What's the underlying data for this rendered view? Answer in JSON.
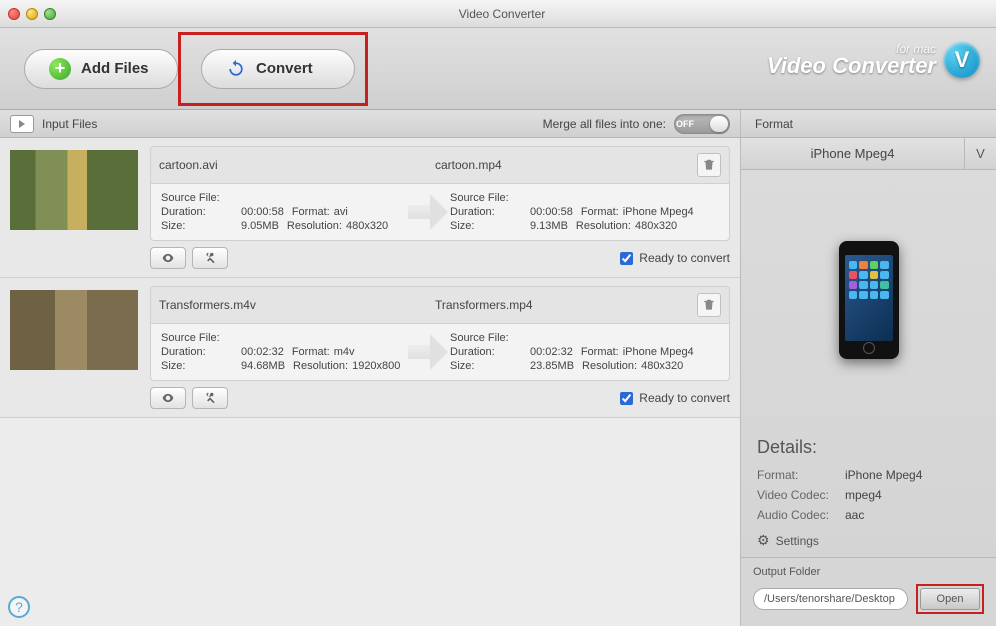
{
  "window": {
    "title": "Video Converter"
  },
  "toolbar": {
    "add_files": "Add Files",
    "convert": "Convert",
    "brand_sub": "for mac",
    "brand_main": "Video Converter",
    "brand_badge": "V"
  },
  "left_subbar": {
    "input_files": "Input Files",
    "merge_label": "Merge all files into one:",
    "toggle_state": "OFF"
  },
  "files": [
    {
      "src_name": "cartoon.avi",
      "dst_name": "cartoon.mp4",
      "src": {
        "source_label": "Source File:",
        "duration_label": "Duration:",
        "duration": "00:00:58",
        "format_label": "Format:",
        "format": "avi",
        "size_label": "Size:",
        "size": "9.05MB",
        "resolution_label": "Resolution:",
        "resolution": "480x320"
      },
      "dst": {
        "source_label": "Source File:",
        "duration_label": "Duration:",
        "duration": "00:00:58",
        "format_label": "Format:",
        "format": "iPhone Mpeg4",
        "size_label": "Size:",
        "size": "9.13MB",
        "resolution_label": "Resolution:",
        "resolution": "480x320"
      },
      "ready_label": "Ready to convert"
    },
    {
      "src_name": "Transformers.m4v",
      "dst_name": "Transformers.mp4",
      "src": {
        "source_label": "Source File:",
        "duration_label": "Duration:",
        "duration": "00:02:32",
        "format_label": "Format:",
        "format": "m4v",
        "size_label": "Size:",
        "size": "94.68MB",
        "resolution_label": "Resolution:",
        "resolution": "1920x800"
      },
      "dst": {
        "source_label": "Source File:",
        "duration_label": "Duration:",
        "duration": "00:02:32",
        "format_label": "Format:",
        "format": "iPhone Mpeg4",
        "size_label": "Size:",
        "size": "23.85MB",
        "resolution_label": "Resolution:",
        "resolution": "480x320"
      },
      "ready_label": "Ready to convert"
    }
  ],
  "right": {
    "format_label": "Format",
    "selected_format": "iPhone Mpeg4",
    "v_tab": "V",
    "details_title": "Details:",
    "format_key": "Format:",
    "format_val": "iPhone Mpeg4",
    "vcodec_key": "Video Codec:",
    "vcodec_val": "mpeg4",
    "acodec_key": "Audio Codec:",
    "acodec_val": "aac",
    "settings": "Settings",
    "output_folder_label": "Output Folder",
    "output_path": "/Users/tenorshare/Desktop",
    "open": "Open"
  }
}
